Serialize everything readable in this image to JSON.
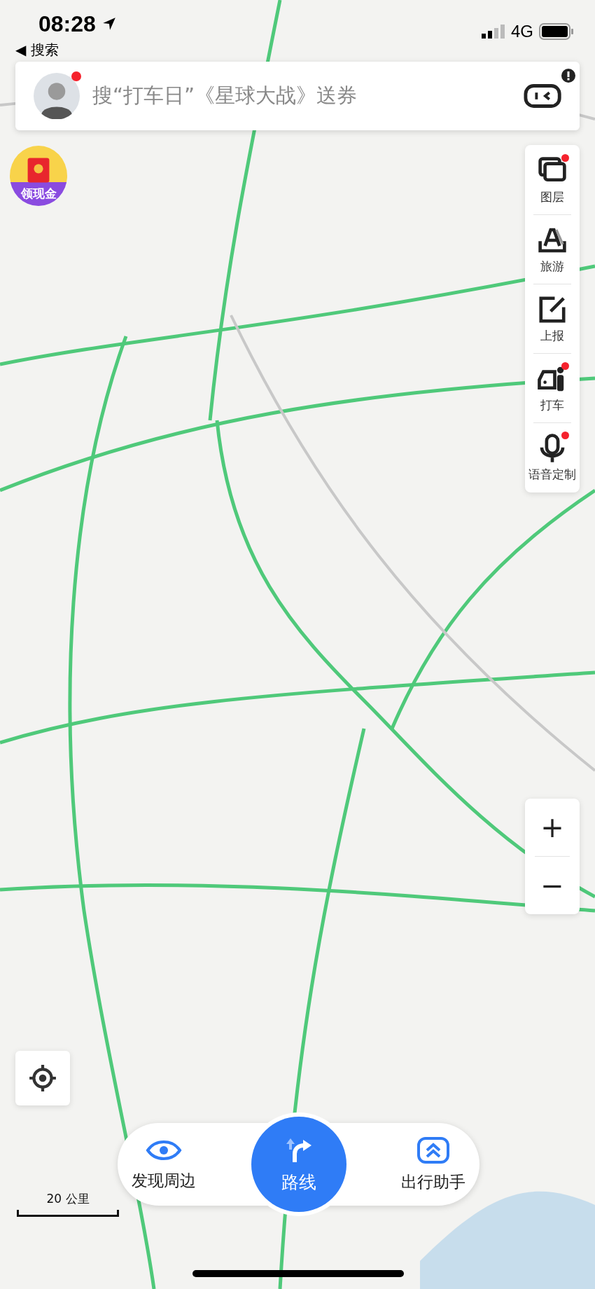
{
  "status_bar": {
    "time": "08:28",
    "back_link": "◀ 搜索",
    "network": "4G"
  },
  "search_bar": {
    "placeholder": "搜“打车日”《星球大战》送券",
    "avatar_badge": true,
    "assistant_badge": true
  },
  "promo": {
    "label": "领现金"
  },
  "side_tools": [
    {
      "label": "图层",
      "kind": "layers",
      "badge": true
    },
    {
      "label": "旅游",
      "kind": "travel",
      "badge": false
    },
    {
      "label": "上报",
      "kind": "report",
      "badge": false
    },
    {
      "label": "打车",
      "kind": "taxi",
      "badge": true
    },
    {
      "label": "语音定制",
      "kind": "voice",
      "badge": true
    }
  ],
  "zoom": {
    "in": "+",
    "out": "−"
  },
  "scale": {
    "label": "20 公里"
  },
  "bottom_nav": [
    {
      "label": "发现周边",
      "kind": "explore"
    },
    {
      "label": "路线",
      "kind": "route"
    },
    {
      "label": "出行助手",
      "kind": "assistant"
    }
  ]
}
